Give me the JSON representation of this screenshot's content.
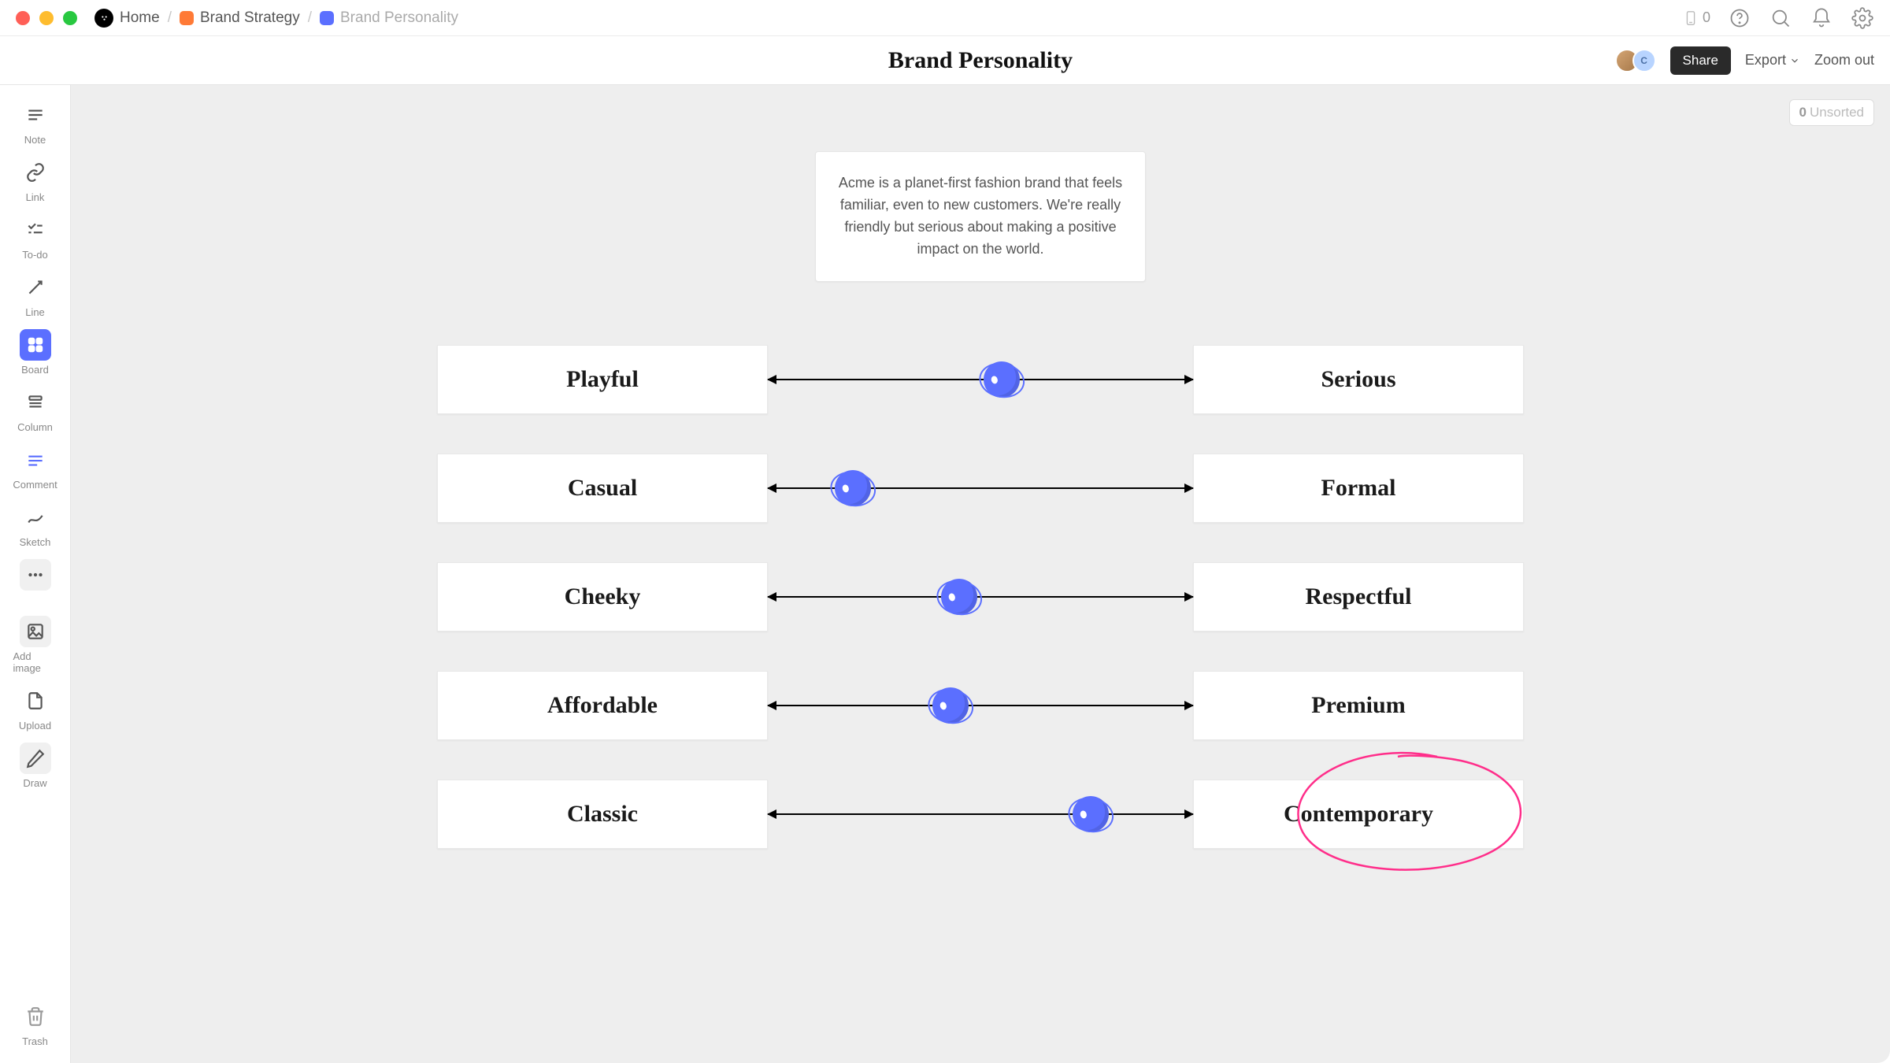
{
  "breadcrumbs": {
    "home": "Home",
    "strategy": "Brand Strategy",
    "personality": "Brand Personality"
  },
  "phone_count": "0",
  "page_title": "Brand Personality",
  "header": {
    "share": "Share",
    "export": "Export",
    "zoom_out": "Zoom out",
    "avatar2_initial": "C"
  },
  "sidebar_tools": {
    "note": "Note",
    "link": "Link",
    "todo": "To-do",
    "line": "Line",
    "board": "Board",
    "column": "Column",
    "comment": "Comment",
    "sketch": "Sketch",
    "add_image": "Add image",
    "upload": "Upload",
    "draw": "Draw",
    "trash": "Trash"
  },
  "unsorted": {
    "count": "0",
    "label": "Unsorted"
  },
  "description": "Acme is a planet-first fashion brand that feels familiar, even to new customers. We're really friendly but serious about making a positive impact on the world.",
  "scales": [
    {
      "left": "Playful",
      "right": "Serious",
      "position": 55
    },
    {
      "left": "Casual",
      "right": "Formal",
      "position": 20
    },
    {
      "left": "Cheeky",
      "right": "Respectful",
      "position": 45
    },
    {
      "left": "Affordable",
      "right": "Premium",
      "position": 43
    },
    {
      "left": "Classic",
      "right": "Contemporary",
      "position": 76,
      "circled": true
    }
  ]
}
